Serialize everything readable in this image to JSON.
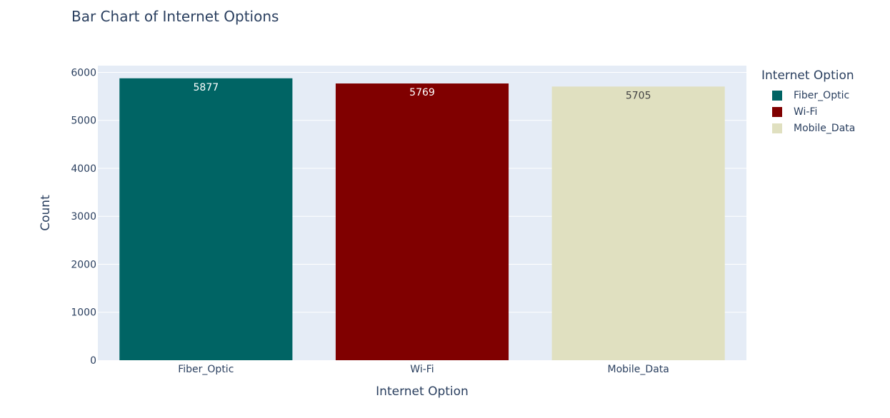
{
  "chart_data": {
    "type": "bar",
    "title": "Bar Chart of Internet Options",
    "xlabel": "Internet Option",
    "ylabel": "Count",
    "categories": [
      "Fiber_Optic",
      "Wi-Fi",
      "Mobile_Data"
    ],
    "values": [
      5877,
      5769,
      5705
    ],
    "colors": [
      "#006464",
      "#800000",
      "#e0e0c0"
    ],
    "label_colors": [
      "#ffffff",
      "#ffffff",
      "#444444"
    ],
    "ylim": [
      0,
      6000
    ],
    "yticks": [
      0,
      1000,
      2000,
      3000,
      4000,
      5000,
      6000
    ],
    "ytick_labels": [
      "0",
      "1000",
      "2000",
      "3000",
      "4000",
      "5000",
      "6000"
    ],
    "grid": true,
    "plot_background": "#e5ecf6",
    "legend": {
      "title": "Internet Option",
      "placement": "right",
      "entries": [
        "Fiber_Optic",
        "Wi-Fi",
        "Mobile_Data"
      ]
    }
  }
}
